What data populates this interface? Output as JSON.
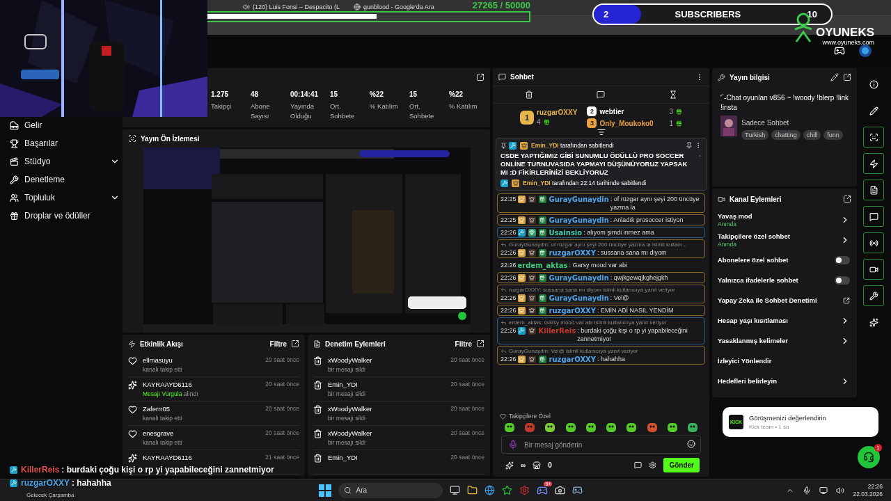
{
  "browser": {
    "tabs": [
      {
        "title": "(120) Luis Fonsi – Despacito (L",
        "kind": "youtube"
      },
      {
        "title": "gunblood - Google'da Ara",
        "kind": "google"
      }
    ]
  },
  "goal": {
    "reading": "27265 / 50000",
    "level": 0.57
  },
  "sub_bar": {
    "current": "2",
    "label": "SUBSCRIBERS",
    "target": "10",
    "level": 0.2
  },
  "logo": {
    "name": "OYUNEKS",
    "url": "www.oyuneks.com"
  },
  "sidebar": {
    "items": [
      {
        "label": "Gelir",
        "expandable": false
      },
      {
        "label": "Başarılar",
        "expandable": false
      },
      {
        "label": "Stüdyo",
        "expandable": true
      },
      {
        "label": "Denetleme",
        "expandable": false
      },
      {
        "label": "Topluluk",
        "expandable": true
      },
      {
        "label": "Droplar ve ödüller",
        "expandable": false
      }
    ]
  },
  "stats": [
    {
      "value": "1.275",
      "label": "Takipçi"
    },
    {
      "value": "48",
      "label": "Abone Sayısı"
    },
    {
      "value": "00:14:41",
      "label": "Yayında Olduğu"
    },
    {
      "value": "15",
      "label": "Ort. Sohbete"
    },
    {
      "value": "%22",
      "label": "% Katılım"
    },
    {
      "value": "15",
      "label": "Ort. Sohbete"
    },
    {
      "value": "%22",
      "label": "% Katılım"
    }
  ],
  "preview": {
    "title": "Yayın Ön İzlemesi",
    "kind": "picture"
  },
  "activity": {
    "title": "Etkinlik Akışı",
    "filter": "Filtre",
    "items": [
      {
        "kind": "follow",
        "user": "ellmasuyu",
        "text": "kanalı takip etti",
        "time": "20 saat önce"
      },
      {
        "kind": "reward",
        "user": "KAYRAAYD6116",
        "highlight": "Mesajı Vurgula",
        "text": "alındı",
        "time": "20 saat önce"
      },
      {
        "kind": "follow",
        "user": "Zaferrr05",
        "text": "kanalı takip etti",
        "time": "20 saat önce"
      },
      {
        "kind": "follow",
        "user": "enesgrave",
        "text": "kanalı takip etti",
        "time": "20 saat önce"
      },
      {
        "kind": "reward",
        "user": "KAYRAAYD6116",
        "time": "21 saat önce"
      }
    ]
  },
  "moderation": {
    "title": "Denetim Eylemleri",
    "filter": "Filtre",
    "items": [
      {
        "user": "xWoodyWalker",
        "text": "bir mesajı sildi",
        "time": "20 saat önce"
      },
      {
        "user": "Emin_YDI",
        "text": "bir mesajı sildi",
        "time": "20 saat önce"
      },
      {
        "user": "xWoodyWalker",
        "text": "bir mesajı sildi",
        "time": "20 saat önce"
      },
      {
        "user": "xWoodyWalker",
        "text": "bir mesajı sildi",
        "time": "20 saat önce"
      },
      {
        "user": "Emin_YDI",
        "time": "20 saat önce"
      }
    ]
  },
  "chat": {
    "title": "Sohbet",
    "leaders": [
      {
        "rank": "1",
        "user": "ruzgarOXXY",
        "count": "4",
        "color": "#e8b54a"
      },
      {
        "rank": "2",
        "user": "webtier",
        "count": "3",
        "color": "#ffffff"
      },
      {
        "rank": "3",
        "user": "Only_Moukoko0",
        "count": "1",
        "color": "#e8a040"
      }
    ],
    "pinned": {
      "by": "Emin_YDI",
      "note": "tarafından sabitlendi",
      "text": "CSDE YAPTIĞIMIZ GİBİ SUNUMLU ÖDÜLLÜ PRO SOCCER ONLİNE TURNUVASIDA YAPMAYI DÜŞÜNÜYORUZ YAPSAK MI :D FİKİRLERİNİZİ BEKLİYORUZ",
      "footer_by": "Emin_YDI",
      "footer": "tarafından 22:14 tarihinde sabitlendi"
    },
    "messages": [
      {
        "time": "22:25",
        "badges": [
          {
            "kind": "crown"
          },
          {
            "kind": "og"
          },
          {
            "kind": "sub"
          }
        ],
        "author": {
          "name": "GurayGunaydin",
          "color": "#4fa3e8"
        },
        "text": ": of rüzgar aynı şeyi 200 üncüye yazma la",
        "color": "#8a6a2a"
      },
      {
        "time": "22:25",
        "badges": [
          {
            "kind": "crown"
          },
          {
            "kind": "og"
          },
          {
            "kind": "sub"
          }
        ],
        "author": {
          "name": "GurayGunaydin",
          "color": "#4fa3e8"
        },
        "text": ": Anladık prosoccer istiyon",
        "color": "#8a6a2a"
      },
      {
        "time": "22:26",
        "badges": [
          {
            "kind": "mod"
          },
          {
            "kind": "vip"
          },
          {
            "kind": "sub"
          }
        ],
        "author": {
          "name": "Usainsio",
          "color": "#3fc9a8"
        },
        "text": ": alıyom şimdi inmez ama",
        "color": "#2a5a8a"
      },
      {
        "reply": "GurayGunaydin: of rüzgar aynı şeyi 200 üncüye yazma la isimli kullanı...",
        "time": "22:26",
        "badges": [
          {
            "kind": "crown"
          },
          {
            "kind": "og"
          },
          {
            "kind": "sub"
          }
        ],
        "author": {
          "name": "ruzgarOXXY",
          "color": "#4fa3e8"
        },
        "text": ": sussana sana mı diyom",
        "color": "#8a6a2a"
      },
      {
        "time": "22:26",
        "author": {
          "name": "erdem_aktas",
          "color": "#3fc97a"
        },
        "text": ": Garsy mood var abi"
      },
      {
        "time": "22:26",
        "badges": [
          {
            "kind": "crown"
          },
          {
            "kind": "og"
          },
          {
            "kind": "sub"
          }
        ],
        "author": {
          "name": "GurayGunaydin",
          "color": "#4fa3e8"
        },
        "text": ": qwjkgewqjkghejgkh",
        "color": "#8a6a2a"
      },
      {
        "reply": "ruzgarOXXY: sussana sana mı diyom isimli kullanıcıya yanıt veriyor",
        "time": "22:26",
        "badges": [
          {
            "kind": "crown"
          },
          {
            "kind": "og"
          },
          {
            "kind": "sub"
          }
        ],
        "author": {
          "name": "GurayGunaydin",
          "color": "#4fa3e8"
        },
        "text": ": Vel@",
        "color": "#8a6a2a"
      },
      {
        "time": "22:26",
        "badges": [
          {
            "kind": "crown"
          },
          {
            "kind": "og"
          },
          {
            "kind": "sub"
          }
        ],
        "author": {
          "name": "ruzgarOXXY",
          "color": "#4fa3e8"
        },
        "text": ": EMİN ABİ NASIL YENDİM",
        "color": "#8a6a2a"
      },
      {
        "reply": "erdem_aktas: Garsy mood var abi isimli kullanıcıya yanıt veriyor",
        "time": "22:26",
        "badges": [
          {
            "kind": "mod"
          },
          {
            "kind": "og"
          }
        ],
        "author": {
          "name": "KillerReis",
          "color": "#c0392b"
        },
        "text": ": burdaki çoğu kişi o rp yi yapabileceğini zannetmiyor",
        "color": "#2a5a8a"
      },
      {
        "reply": "GurayGunaydin: Vel@ isimli kullanıcıya yanıt veriyor",
        "time": "22:26",
        "badges": [
          {
            "kind": "crown"
          },
          {
            "kind": "og"
          },
          {
            "kind": "sub"
          }
        ],
        "author": {
          "name": "ruzgarOXXY",
          "color": "#4fa3e8"
        },
        "text": ": hahahha",
        "color": "#8a6a2a"
      }
    ],
    "mode": "Takipçilere Özel",
    "placeholder": "Bir mesaj gönderin",
    "points": "∞",
    "store": "0",
    "send": "Gönder"
  },
  "stream_info": {
    "title": "Yayın bilgisi",
    "stream_title": "'`-Chat oyunları v856 ~ !woody !blerp !link !insta",
    "category": "Sadece Sohbet",
    "tags": [
      "Turkish",
      "chatting",
      "chill",
      "funn"
    ]
  },
  "channel_actions": {
    "title": "Kanal Eylemleri",
    "items": [
      {
        "kind": "chevron",
        "label": "Yavaş mod",
        "sub": "Anında"
      },
      {
        "kind": "chevron",
        "label": "Takipçilere özel sohbet",
        "sub": "Anında"
      },
      {
        "kind": "toggle",
        "label": "Abonelere özel sohbet",
        "on": false
      },
      {
        "kind": "toggle",
        "label": "Yalnızca ifadelerle sohbet",
        "on": false
      },
      {
        "kind": "external",
        "label": "Yapay Zeka ile Sohbet Denetimi"
      },
      {
        "kind": "chevron",
        "label": "Hesap yaşı kısıtlaması"
      },
      {
        "kind": "chevron",
        "label": "Yasaklanmış kelimeler"
      },
      {
        "kind": "plain",
        "label": "İzleyici Yönlendir"
      },
      {
        "kind": "chevron",
        "label": "Hedefleri belirleyin"
      }
    ]
  },
  "toast": {
    "logo": "KICK",
    "title": "Görüşmenizi değerlendirin",
    "meta": "Kick team • 1 sa"
  },
  "support": {
    "badge": "1"
  },
  "overlay_chat": [
    {
      "user": "KillerReis",
      "color": "#e05050",
      "text": " : burdaki çoğu kişi o rp yi yapabileceğini zannetmiyor"
    },
    {
      "user": "ruzgarOXXY",
      "color": "#4fa3e8",
      "text": " : hahahha"
    }
  ],
  "taskbar": {
    "weather": "Gelecek Çarşamba",
    "search": "Ara",
    "discord_badge": "9+",
    "time": "22:26",
    "date": "22.03.2026"
  }
}
